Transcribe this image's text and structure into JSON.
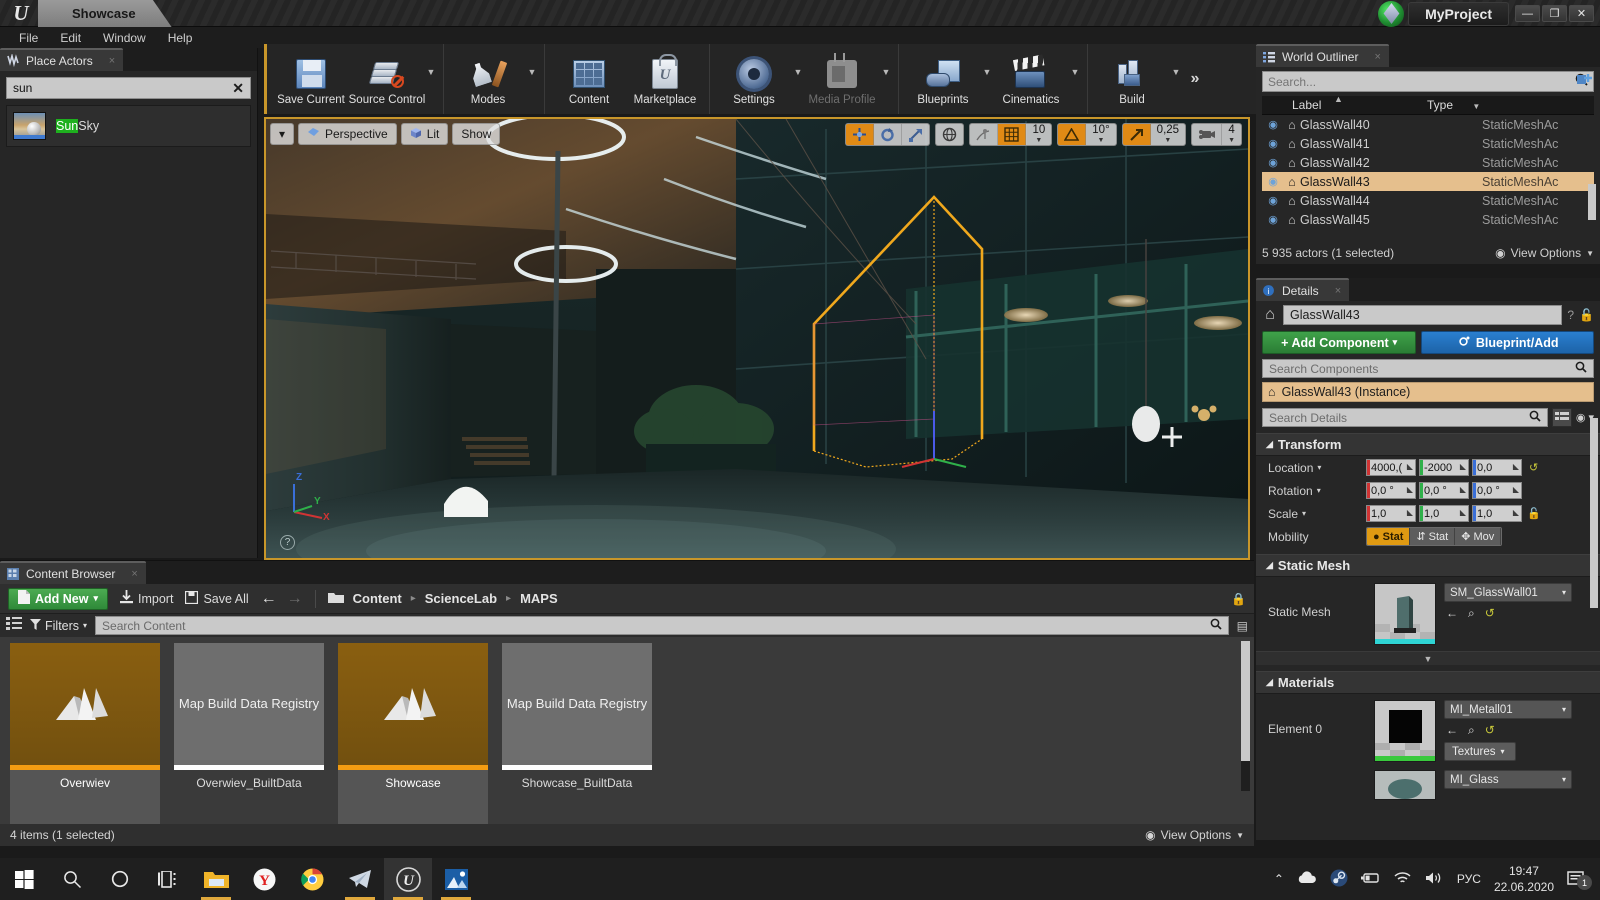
{
  "titlebar": {
    "tab_label": "Showcase",
    "project_name": "MyProject",
    "minimize": "—",
    "maximize": "❐",
    "close": "✕"
  },
  "menubar": {
    "items": [
      "File",
      "Edit",
      "Window",
      "Help"
    ]
  },
  "place_actors": {
    "tab_label": "Place Actors",
    "search_value": "sun",
    "clear_label": "✕",
    "results": [
      {
        "name_highlight": "Sun",
        "name_rest": "Sky"
      }
    ]
  },
  "toolbar": {
    "groups": [
      {
        "buttons": [
          {
            "label": "Save Current",
            "icon": "floppy-disk-icon",
            "caret": false,
            "dim": false
          },
          {
            "label": "Source Control",
            "icon": "source-control-icon",
            "caret": true,
            "dim": false
          }
        ]
      },
      {
        "buttons": [
          {
            "label": "Modes",
            "icon": "modes-wrench-icon",
            "caret": true,
            "dim": false
          }
        ]
      },
      {
        "buttons": [
          {
            "label": "Content",
            "icon": "content-grid-icon",
            "caret": false,
            "dim": false
          },
          {
            "label": "Marketplace",
            "icon": "marketplace-bag-icon",
            "caret": false,
            "dim": false
          }
        ]
      },
      {
        "buttons": [
          {
            "label": "Settings",
            "icon": "gear-icon",
            "caret": true,
            "dim": false
          },
          {
            "label": "Media Profile",
            "icon": "tv-icon",
            "caret": true,
            "dim": true
          }
        ]
      },
      {
        "buttons": [
          {
            "label": "Blueprints",
            "icon": "blueprint-icon",
            "caret": true,
            "dim": false
          },
          {
            "label": "Cinematics",
            "icon": "clapperboard-icon",
            "caret": true,
            "dim": false
          }
        ]
      },
      {
        "buttons": [
          {
            "label": "Build",
            "icon": "build-blocks-icon",
            "caret": true,
            "dim": false
          }
        ]
      }
    ],
    "overflow": "»"
  },
  "viewport": {
    "menu_caret": "▾",
    "camera_mode": "Perspective",
    "view_mode": "Lit",
    "show_label": "Show",
    "transform_tools": [
      "move-gizmo-icon",
      "rotate-gizmo-icon",
      "scale-gizmo-icon"
    ],
    "coord_system": "world-globe-icon",
    "surface_snap": "surface-snap-icon",
    "grid_snap_enabled": true,
    "grid_snap_value": "10",
    "angle_snap_enabled": true,
    "angle_snap_value": "10°",
    "scale_snap_enabled": true,
    "scale_snap_value": "0,25",
    "camera_speed_value": "4",
    "axis_labels": {
      "x": "X",
      "y": "Y",
      "z": "Z"
    },
    "help_glyph": "?"
  },
  "outliner": {
    "tab_label": "World Outliner",
    "search_placeholder": "Search...",
    "columns": {
      "label": "Label",
      "type": "Type"
    },
    "rows": [
      {
        "label": "GlassWall40",
        "type": "StaticMeshAc",
        "selected": false
      },
      {
        "label": "GlassWall41",
        "type": "StaticMeshAc",
        "selected": false
      },
      {
        "label": "GlassWall42",
        "type": "StaticMeshAc",
        "selected": false
      },
      {
        "label": "GlassWall43",
        "type": "StaticMeshAc",
        "selected": true
      },
      {
        "label": "GlassWall44",
        "type": "StaticMeshAc",
        "selected": false
      },
      {
        "label": "GlassWall45",
        "type": "StaticMeshAc",
        "selected": false
      }
    ],
    "status": "5 935 actors (1 selected)",
    "view_options": "View Options"
  },
  "details": {
    "tab_label": "Details",
    "actor_name": "GlassWall43",
    "help_glyph": "?",
    "lock_glyph": "🔓",
    "add_component": "+ Add Component",
    "add_component_caret": "▾",
    "blueprint_add": "Blueprint/Add",
    "search_components_placeholder": "Search Components",
    "component_item": "GlassWall43 (Instance)",
    "search_details_placeholder": "Search Details",
    "sections": {
      "transform": {
        "title": "Transform",
        "rows": [
          {
            "label": "Location",
            "caret": "▾",
            "values": [
              "4000,(",
              "-2000",
              "0,0"
            ]
          },
          {
            "label": "Rotation",
            "caret": "▾",
            "values": [
              "0,0 °",
              "0,0 °",
              "0,0 °"
            ]
          },
          {
            "label": "Scale",
            "caret": "▾",
            "values": [
              "1,0",
              "1,0",
              "1,0"
            ]
          }
        ],
        "mobility_label": "Mobility",
        "mobility": [
          {
            "text": "Stat",
            "active": true
          },
          {
            "text": "Stat",
            "active": false
          },
          {
            "text": "Mov",
            "active": false
          }
        ]
      },
      "static_mesh": {
        "title": "Static Mesh",
        "row_label": "Static Mesh",
        "asset_name": "SM_GlassWall01",
        "caret": "▾",
        "accent": "#2fd4d4"
      },
      "materials": {
        "title": "Materials",
        "rows": [
          {
            "label": "Element 0",
            "asset_name": "MI_Metall01",
            "caret": "▾",
            "extra_button": "Textures",
            "extra_caret": "▾",
            "accent": "#39c93d"
          },
          {
            "label": "",
            "asset_name": "MI_Glass",
            "caret": "▾",
            "accent": "#888888"
          }
        ]
      }
    }
  },
  "content_browser": {
    "tab_label": "Content Browser",
    "add_new": "Add New",
    "add_new_caret": "▾",
    "import": "Import",
    "save_all": "Save All",
    "back_arrow": "←",
    "forward_arrow": "→",
    "breadcrumb": [
      "Content",
      "ScienceLab",
      "MAPS"
    ],
    "breadcrumb_sep": "▸",
    "filters": "Filters",
    "filters_caret": "▾",
    "search_placeholder": "Search Content",
    "items": [
      {
        "caption": "Overwiev",
        "kind": "map",
        "title": "",
        "selected": true,
        "bar": "#f39c12"
      },
      {
        "caption": "Overwiev_BuiltData",
        "kind": "registry",
        "title": "Map Build Data Registry",
        "selected": false,
        "bar": "#ffffff"
      },
      {
        "caption": "Showcase",
        "kind": "map",
        "title": "",
        "selected": true,
        "bar": "#f39c12"
      },
      {
        "caption": "Showcase_BuiltData",
        "kind": "registry",
        "title": "Map Build Data Registry",
        "selected": false,
        "bar": "#ffffff"
      }
    ],
    "status": "4 items (1 selected)",
    "view_options": "View Options"
  },
  "taskbar": {
    "items": [
      {
        "icon": "windows-start-icon",
        "active": false,
        "open": false
      },
      {
        "icon": "search-icon",
        "active": false,
        "open": false
      },
      {
        "icon": "cortana-circle-icon",
        "active": false,
        "open": false
      },
      {
        "icon": "task-view-icon",
        "active": false,
        "open": false
      },
      {
        "icon": "file-explorer-icon",
        "active": false,
        "open": true
      },
      {
        "icon": "yandex-browser-icon",
        "active": false,
        "open": false
      },
      {
        "icon": "chrome-icon",
        "active": false,
        "open": false
      },
      {
        "icon": "telegram-icon",
        "active": false,
        "open": true
      },
      {
        "icon": "unreal-engine-icon",
        "active": true,
        "open": true
      },
      {
        "icon": "photos-icon",
        "active": false,
        "open": true
      }
    ],
    "tray": {
      "chevron": "⌃",
      "cloud": "cloud-icon",
      "steam": "steam-icon",
      "battery": "battery-icon",
      "wifi": "wifi-icon",
      "volume": "volume-icon",
      "language": "РУС",
      "time": "19:47",
      "date": "22.06.2020",
      "notifications_count": "1"
    }
  },
  "colors": {
    "accent_orange": "#c8962a",
    "selection_tan": "#e5bf8d",
    "green_button": "#3fa24a",
    "blue_button": "#2a7fd0",
    "panel_bg": "#262626"
  }
}
